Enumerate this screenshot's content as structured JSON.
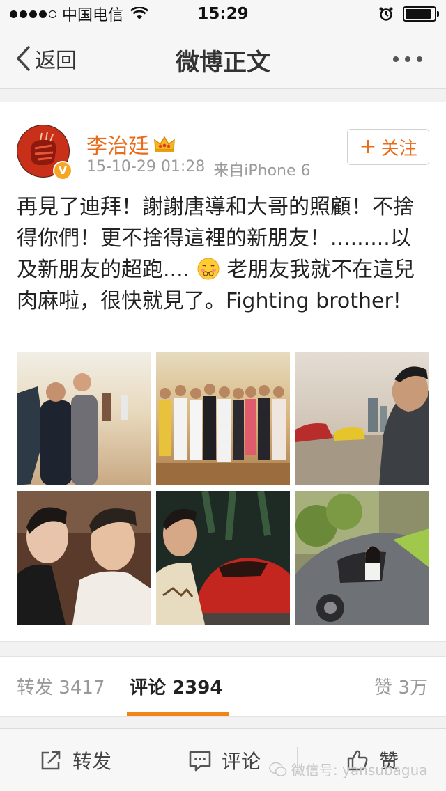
{
  "status_bar": {
    "carrier": "中国电信",
    "time": "15:29",
    "signal_bars": 4,
    "battery_level": 0.9
  },
  "nav": {
    "back_label": "返回",
    "title": "微博正文"
  },
  "post": {
    "author": "李治廷",
    "date": "15-10-29 01:28",
    "source": "来自iPhone 6",
    "follow_label": "关注",
    "verified_label": "V",
    "text_part1": "再見了迪拜！謝謝唐導和大哥的照顧！不捨得你們！更不捨得這裡的新朋友！.........以及新朋友的超跑.... ",
    "text_part2": " 老朋友我就不在這兒肉麻啦，很快就見了。Fighting brother!",
    "photos": [
      "desert-group-photo",
      "desert-large-group-photo",
      "selfie-with-supercars",
      "selfie-with-friend",
      "selfie-with-red-sports-car",
      "woman-in-green-sports-car"
    ]
  },
  "stats": {
    "reposts_label": "转发",
    "reposts_count": "3417",
    "comments_label": "评论",
    "comments_count": "2394",
    "likes_label": "赞",
    "likes_count": "3万"
  },
  "toolbar": {
    "repost_label": "转发",
    "comment_label": "评论",
    "like_label": "赞"
  },
  "watermark": "微信号: yansubagua",
  "colors": {
    "accent": "#e86c1a",
    "tab_underline": "#f08419",
    "badge": "#f5a623"
  }
}
